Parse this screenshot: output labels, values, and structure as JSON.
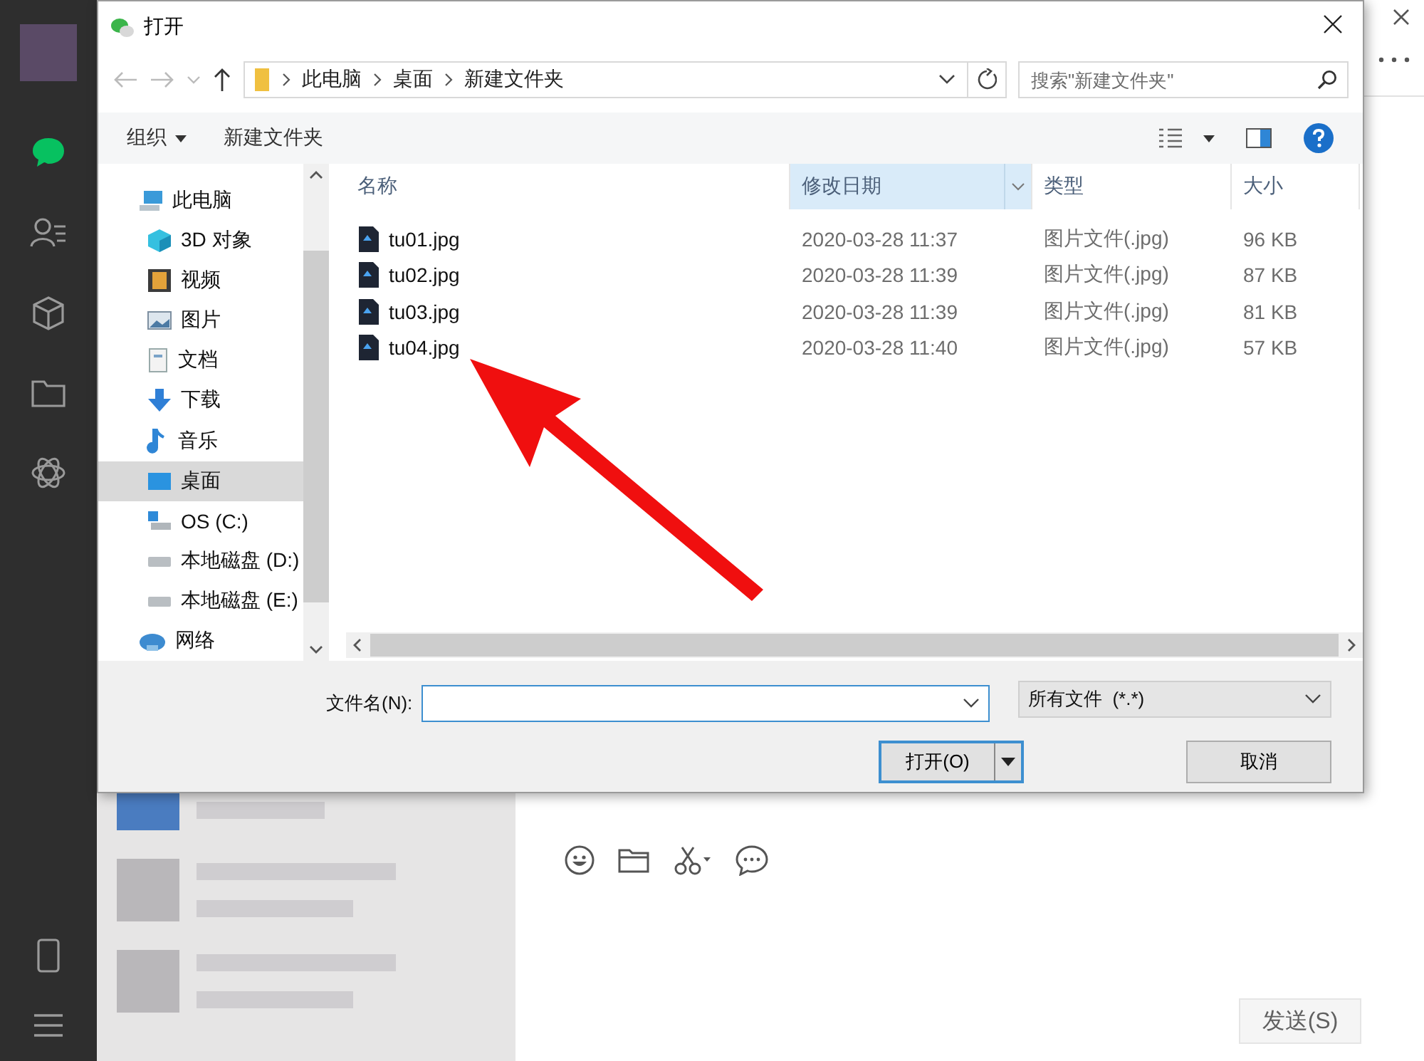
{
  "dialog": {
    "title": "打开",
    "breadcrumb": [
      "此电脑",
      "桌面",
      "新建文件夹"
    ],
    "search": {
      "placeholder": "搜索\"新建文件夹\""
    },
    "toolbar": {
      "organize": "组织",
      "new_folder": "新建文件夹"
    },
    "nav": [
      {
        "label": "此电脑",
        "kind": "pc",
        "selected": false,
        "children": [
          {
            "label": "3D 对象",
            "kind": "cube",
            "selected": false
          },
          {
            "label": "视频",
            "kind": "video",
            "selected": false
          },
          {
            "label": "图片",
            "kind": "picture",
            "selected": false
          },
          {
            "label": "文档",
            "kind": "doc",
            "selected": false
          },
          {
            "label": "下载",
            "kind": "download",
            "selected": false
          },
          {
            "label": "音乐",
            "kind": "music",
            "selected": false
          },
          {
            "label": "桌面",
            "kind": "desktop",
            "selected": true
          },
          {
            "label": "OS (C:)",
            "kind": "os-drive",
            "selected": false
          },
          {
            "label": "本地磁盘 (D:)",
            "kind": "drive",
            "selected": false
          },
          {
            "label": "本地磁盘 (E:)",
            "kind": "drive",
            "selected": false
          }
        ]
      },
      {
        "label": "网络",
        "kind": "network",
        "selected": false
      }
    ],
    "columns": [
      {
        "label": "名称",
        "selected": false
      },
      {
        "label": "修改日期",
        "selected": true
      },
      {
        "label": "类型",
        "selected": false
      },
      {
        "label": "大小",
        "selected": false
      }
    ],
    "files": [
      {
        "name": "tu01.jpg",
        "date": "2020-03-28 11:37",
        "type": "图片文件(.jpg)",
        "size": "96 KB"
      },
      {
        "name": "tu02.jpg",
        "date": "2020-03-28 11:39",
        "type": "图片文件(.jpg)",
        "size": "87 KB"
      },
      {
        "name": "tu03.jpg",
        "date": "2020-03-28 11:39",
        "type": "图片文件(.jpg)",
        "size": "81 KB"
      },
      {
        "name": "tu04.jpg",
        "date": "2020-03-28 11:40",
        "type": "图片文件(.jpg)",
        "size": "57 KB"
      }
    ],
    "filename_label": "文件名(N):",
    "filetype": "所有文件  (*.*)",
    "open_button": "打开(O)",
    "cancel_button": "取消"
  },
  "chat": {
    "send_button": "发送(S)"
  }
}
